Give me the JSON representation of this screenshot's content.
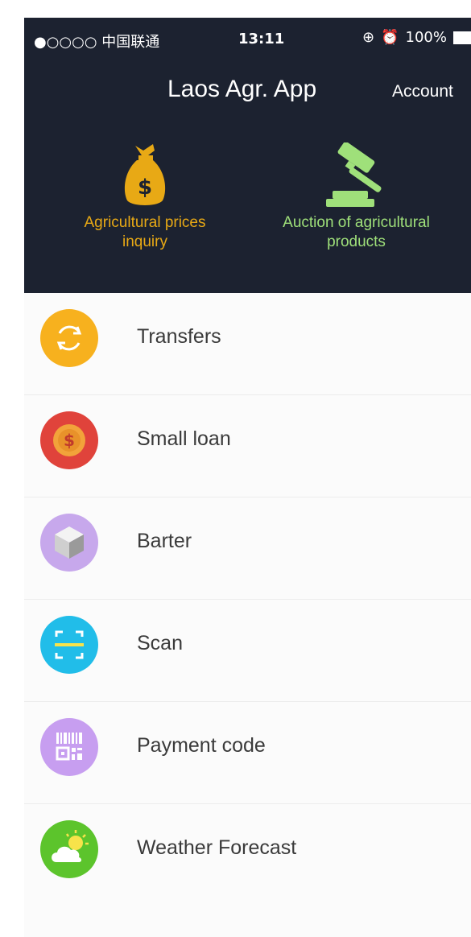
{
  "status_bar": {
    "carrier": "●○○○○ 中国联通",
    "time": "13:11",
    "battery": "100%"
  },
  "header": {
    "title": "Laos Agr. App",
    "account_label": "Account"
  },
  "quick_actions": [
    {
      "label_line1": "Agricultural prices",
      "label_line2": "inquiry",
      "icon": "money-bag-icon",
      "color": "#e8a915"
    },
    {
      "label_line1": "Auction of agricultural",
      "label_line2": "products",
      "icon": "gavel-icon",
      "color": "#9fe07a"
    }
  ],
  "menu": [
    {
      "label": "Transfers",
      "icon": "transfer-icon",
      "color": "#f7b11e"
    },
    {
      "label": "Small loan",
      "icon": "coin-icon",
      "color": "#e0433b"
    },
    {
      "label": "Barter",
      "icon": "cube-icon",
      "color": "#c7a8ec"
    },
    {
      "label": "Scan",
      "icon": "scan-icon",
      "color": "#21bde9"
    },
    {
      "label": "Payment code",
      "icon": "barcode-icon",
      "color": "#c79ef0"
    },
    {
      "label": "Weather Forecast",
      "icon": "weather-icon",
      "color": "#5cc42c"
    }
  ]
}
